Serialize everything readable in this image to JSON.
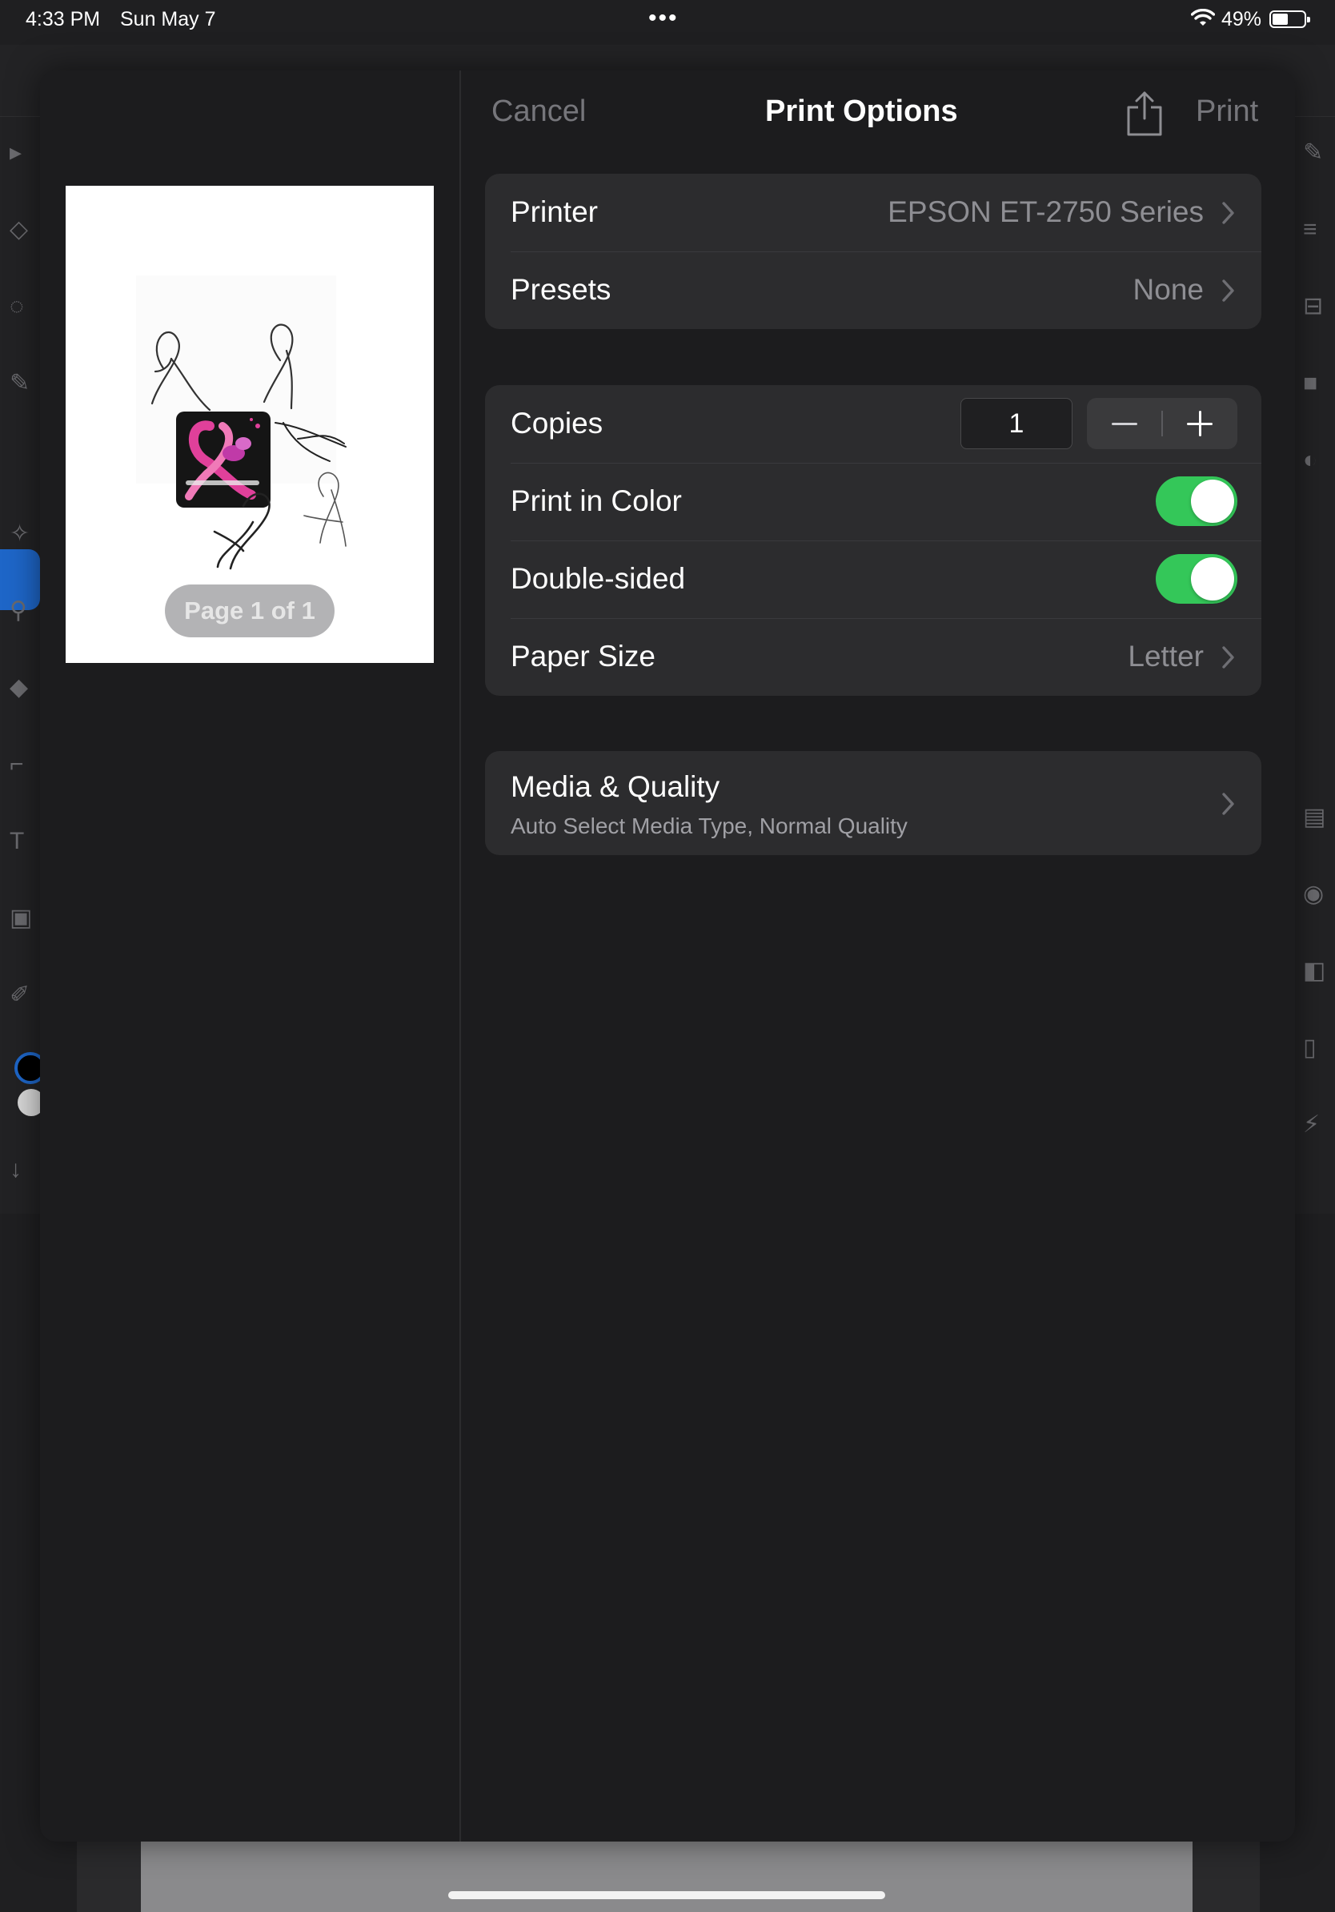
{
  "status_bar": {
    "time": "4:33 PM",
    "date": "Sun May 7",
    "battery_percent": "49%",
    "battery_level": 0.49
  },
  "print_options": {
    "cancel_label": "Cancel",
    "title": "Print Options",
    "print_label": "Print",
    "page_indicator": "Page 1 of 1",
    "printer": {
      "label": "Printer",
      "value": "EPSON ET-2750 Series"
    },
    "presets": {
      "label": "Presets",
      "value": "None"
    },
    "copies": {
      "label": "Copies",
      "value": "1"
    },
    "print_in_color": {
      "label": "Print in Color",
      "on": true
    },
    "double_sided": {
      "label": "Double-sided",
      "on": true
    },
    "paper_size": {
      "label": "Paper Size",
      "value": "Letter"
    },
    "media_quality": {
      "label": "Media & Quality",
      "detail": "Auto Select Media Type, Normal Quality"
    }
  },
  "colors": {
    "toggle_on": "#34c759",
    "sheet_background": "#1c1c1e",
    "group_background": "#2c2c2e",
    "secondary_text": "#8e8e93",
    "ribbon_pink": "#e0409a"
  },
  "icons": {
    "share": "share-icon",
    "chevron": "chevron-right-icon",
    "wifi": "wifi-icon",
    "battery": "battery-icon",
    "more": "more-dots-icon"
  }
}
